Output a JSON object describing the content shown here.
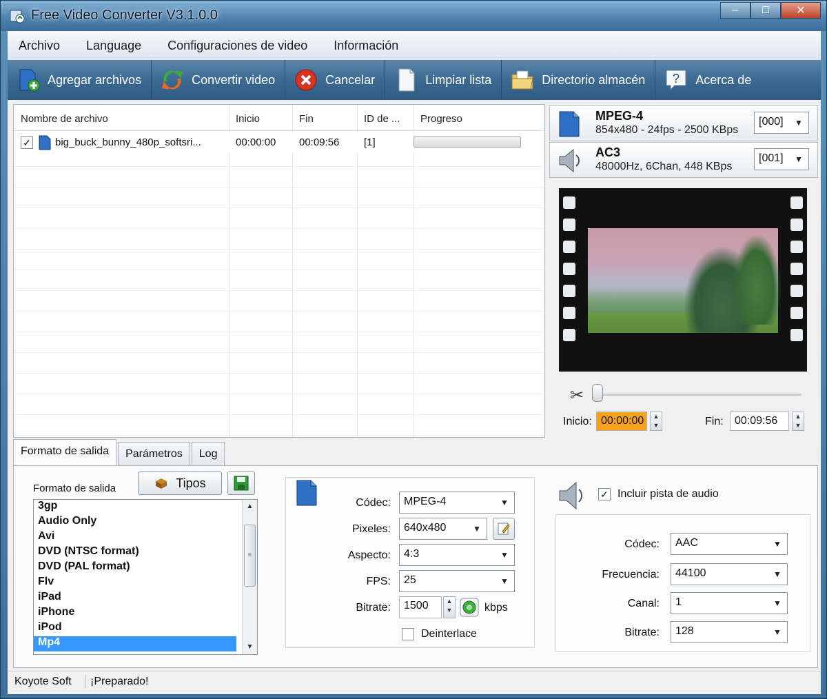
{
  "window": {
    "title": "Free Video Converter V3.1.0.0"
  },
  "menu": [
    "Archivo",
    "Language",
    "Configuraciones de video",
    "Información"
  ],
  "toolbar": [
    {
      "label": "Agregar archivos",
      "icon": "add-files-icon"
    },
    {
      "label": "Convertir video",
      "icon": "convert-icon"
    },
    {
      "label": "Cancelar",
      "icon": "cancel-icon"
    },
    {
      "label": "Limpiar lista",
      "icon": "clear-list-icon"
    },
    {
      "label": "Directorio almacén",
      "icon": "folder-icon"
    },
    {
      "label": "Acerca de",
      "icon": "help-icon"
    }
  ],
  "file_list": {
    "columns": [
      "Nombre de archivo",
      "Inicio",
      "Fin",
      "ID de ...",
      "Progreso"
    ],
    "rows": [
      {
        "checked": true,
        "name": "big_buck_bunny_480p_softsri...",
        "start": "00:00:00",
        "end": "00:09:56",
        "id": "[1]",
        "progress": 0
      }
    ]
  },
  "streams": {
    "video": {
      "name": "MPEG-4",
      "desc": "854x480 - 24fps - 2500 KBps",
      "track": "[000]"
    },
    "audio": {
      "name": "AC3",
      "desc": "48000Hz, 6Chan, 448 KBps",
      "track": "[001]"
    }
  },
  "trim": {
    "start_label": "Inicio:",
    "start": "00:00:00",
    "end_label": "Fin:",
    "end": "00:09:56",
    "position": 0
  },
  "tabs": [
    "Formato de salida",
    "Parámetros",
    "Log"
  ],
  "output": {
    "format_label": "Formato de salida",
    "types_button": "Tipos",
    "formats": [
      "3gp",
      "Audio Only",
      "Avi",
      "DVD (NTSC format)",
      "DVD (PAL format)",
      "Flv",
      "iPad",
      "iPhone",
      "iPod",
      "Mp4"
    ],
    "selected": "Mp4"
  },
  "video_settings": {
    "codec_label": "Códec:",
    "codec": "MPEG-4",
    "pixels_label": "Pixeles:",
    "pixels": "640x480",
    "aspect_label": "Aspecto:",
    "aspect": "4:3",
    "fps_label": "FPS:",
    "fps": "25",
    "bitrate_label": "Bitrate:",
    "bitrate": "1500",
    "bitrate_unit": "kbps",
    "deinterlace_label": "Deinterlace",
    "deinterlace": false
  },
  "audio_settings": {
    "include_label": "Incluir pista de audio",
    "include": true,
    "codec_label": "Códec:",
    "codec": "AAC",
    "freq_label": "Frecuencia:",
    "freq": "44100",
    "channel_label": "Canal:",
    "channel": "1",
    "bitrate_label": "Bitrate:",
    "bitrate": "128"
  },
  "status": {
    "company": "Koyote Soft",
    "message": "¡Preparado!"
  }
}
